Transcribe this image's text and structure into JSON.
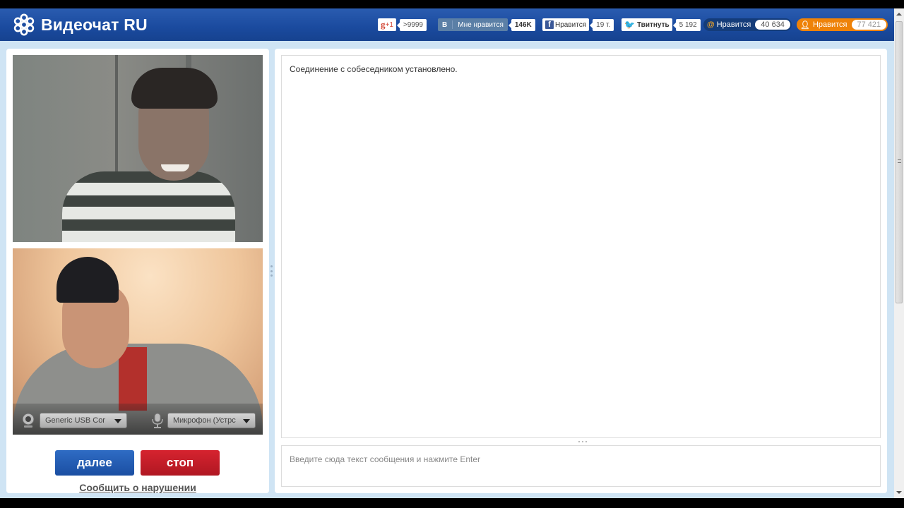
{
  "header": {
    "logo_text": "Видеочат RU",
    "logo_icon": "flower-logo-icon"
  },
  "social": {
    "gplus": {
      "label": "+1",
      "count": ">9999",
      "icon": "google-plus-icon"
    },
    "vk": {
      "icon_label": "B",
      "label": "Мне нравится",
      "count": "146K"
    },
    "facebook": {
      "icon_label": "f",
      "label": "Нравится",
      "count": "19 т."
    },
    "twitter": {
      "label": "Твитнуть",
      "count": "5 192",
      "icon": "twitter-bird-icon"
    },
    "mailru": {
      "icon_label": "@",
      "label": "Нравится",
      "count": "40 634"
    },
    "odnoklassniki": {
      "icon_label": "ok",
      "label": "Нравится",
      "count": "77 421"
    }
  },
  "video": {
    "camera_select": "Generic USB Cor",
    "mic_select": "Микрофон (Устрс"
  },
  "controls": {
    "next_label": "далее",
    "stop_label": "стоп",
    "report_label": "Сообщить о нарушении"
  },
  "chat": {
    "messages": [
      "Соединение с собеседником установлено."
    ],
    "input_placeholder": "Введите сюда текст сообщения и нажмите Enter",
    "input_value": ""
  },
  "colors": {
    "header_blue": "#1a4a9e",
    "next_blue": "#1a4ea2",
    "stop_red": "#b01722",
    "page_bg": "#cfe4f4",
    "ok_orange": "#ee8208"
  }
}
